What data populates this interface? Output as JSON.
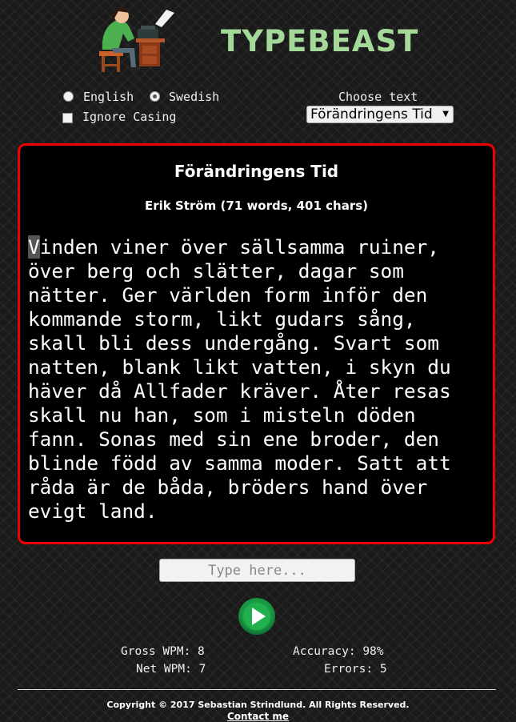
{
  "header": {
    "title": "TYPEBEAST",
    "logo": "typewriter-person-logo"
  },
  "options": {
    "language": {
      "options": [
        "English",
        "Swedish"
      ],
      "selected": "Swedish"
    },
    "ignore_casing": {
      "label": "Ignore Casing",
      "checked": false
    },
    "choose_text_label": "Choose text",
    "selected_text": "Förändringens Tid"
  },
  "text": {
    "title": "Förändringens Tid",
    "meta": "Erik Ström (71 words, 401 chars)",
    "first_char": "V",
    "rest": "inden viner över sällsamma ruiner,\növer berg och slätter, dagar som\nnätter. Ger världen form inför den\nkommande storm, likt gudars sång,\nskall bli dess undergång. Svart som\nnatten, blank likt vatten, i skyn du\nhäver då Allfader kräver. Åter resas\nskall nu han, som i misteln döden\nfann. Sonas med sin ene broder, den\nblinde född av samma moder. Satt att\nråda är de båda, bröders hand över\nevigt land."
  },
  "input": {
    "placeholder": "Type here...",
    "value": ""
  },
  "stats": {
    "gross_wpm_label": "Gross WPM:",
    "gross_wpm": "8",
    "net_wpm_label": "Net WPM:",
    "net_wpm": "7",
    "accuracy_label": "Accuracy:",
    "accuracy": "98%",
    "errors_label": "Errors:",
    "errors": "5"
  },
  "footer": {
    "copyright": "Copyright © 2017 Sebastian Strindlund. All Rights Reserved.",
    "contact": "Contact me"
  },
  "colors": {
    "accent_border": "#e00000",
    "title_green": "#a4d99a",
    "play_green": "#199a45"
  }
}
